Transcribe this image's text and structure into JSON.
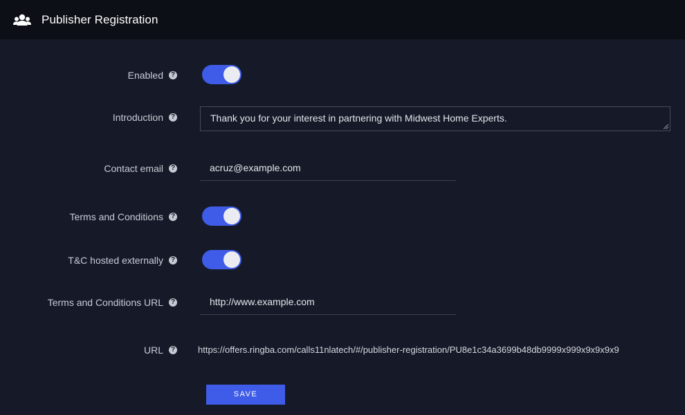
{
  "header": {
    "icon": "users-icon",
    "title": "Publisher Registration"
  },
  "form": {
    "enabled": {
      "label": "Enabled",
      "value": true
    },
    "introduction": {
      "label": "Introduction",
      "value": "Thank you for your interest in partnering with Midwest Home Experts."
    },
    "contact_email": {
      "label": "Contact email",
      "value": "acruz@example.com"
    },
    "terms": {
      "label": "Terms and Conditions",
      "value": true
    },
    "tc_external": {
      "label": "T&C hosted externally",
      "value": true
    },
    "terms_url": {
      "label": "Terms and Conditions URL",
      "value": "http://www.example.com"
    },
    "url": {
      "label": "URL",
      "value": "https://offers.ringba.com/calls11nlatech/#/publisher-registration/PU8e1c34a3699b48db9999x999x9x9x9x9"
    }
  },
  "help_icon": "question-circle-icon",
  "save_label": "SAVE",
  "colors": {
    "background": "#161a28",
    "header_background": "#0d0f16",
    "accent": "#3f5ce8"
  }
}
